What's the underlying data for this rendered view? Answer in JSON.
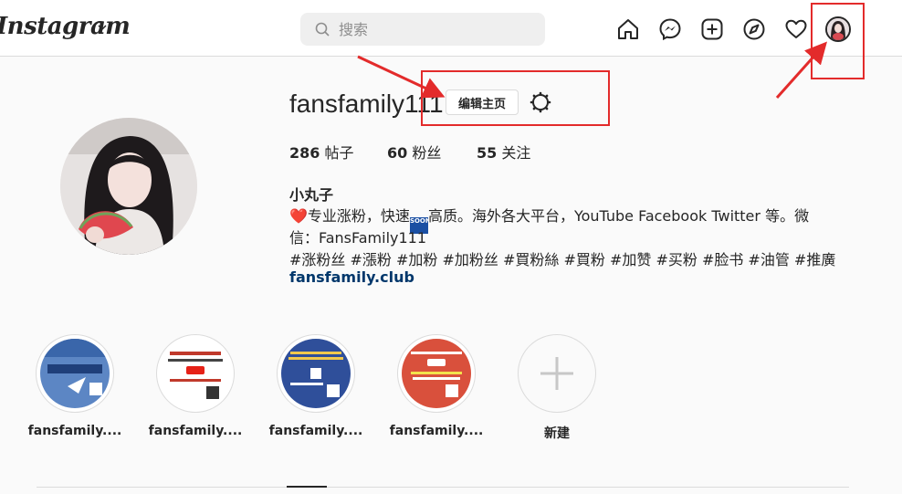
{
  "header": {
    "logo_text": "Instagram",
    "search_placeholder": "搜索",
    "nav_icons": [
      "home-icon",
      "messenger-icon",
      "new-post-icon",
      "explore-icon",
      "activity-heart-icon",
      "profile-avatar"
    ]
  },
  "profile": {
    "username": "fansfamily111",
    "edit_button_label": "编辑主页",
    "stats": {
      "posts_count": "286",
      "posts_label": " 帖子",
      "followers_count": "60",
      "followers_label": " 粉丝",
      "following_count": "55",
      "following_label": " 关注"
    },
    "bio": {
      "name": "小丸子",
      "line1_heart": "❤️",
      "line1_a": "专业涨粉，快速",
      "line1_soon": "SOON",
      "line1_b": "高质。海外各大平台，YouTube Facebook Twitter 等。微",
      "line2": "信：FansFamily111",
      "line3": "#涨粉丝 #漲粉 #加粉 #加粉丝 #買粉絲 #買粉 #加赞 #买粉 #脸书 #油管 #推廣",
      "link": "fansfamily.club"
    }
  },
  "highlights": [
    {
      "label": "fansfamily....",
      "color": "#3e6fb5"
    },
    {
      "label": "fansfamily....",
      "color": "#ffffff"
    },
    {
      "label": "fansfamily....",
      "color": "#2f4f9a"
    },
    {
      "label": "fansfamily....",
      "color": "#d9503c"
    },
    {
      "label": "新建",
      "color": "#ffffff"
    }
  ],
  "annotation_color": "#e32b2b"
}
